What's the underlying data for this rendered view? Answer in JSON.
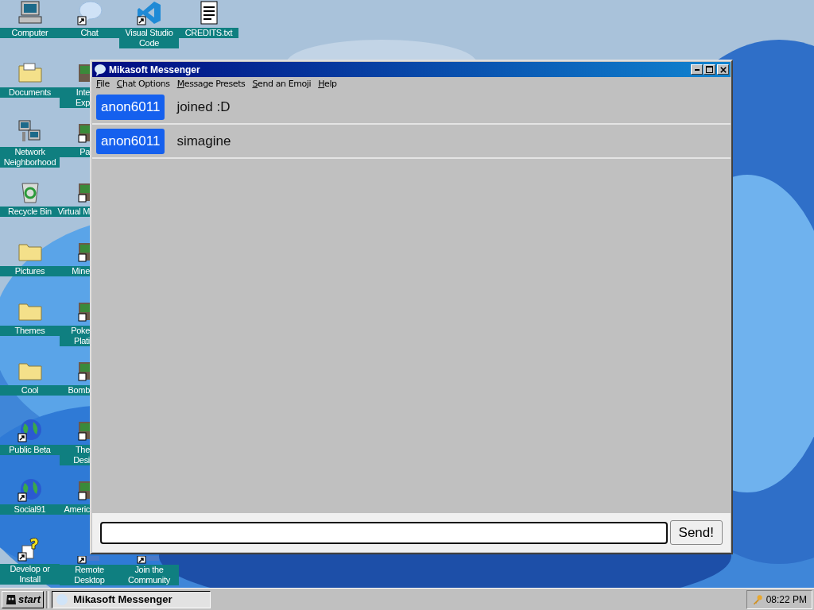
{
  "desktop": {
    "columns": [
      {
        "items": [
          {
            "kind": "computer",
            "shortcut": false,
            "lines": [
              "Computer"
            ]
          },
          {
            "kind": "folder-docs",
            "shortcut": false,
            "lines": [
              "Documents"
            ]
          },
          {
            "kind": "network",
            "shortcut": false,
            "lines": [
              "Network",
              "Neighborhood"
            ]
          },
          {
            "kind": "recycle",
            "shortcut": false,
            "lines": [
              "Recycle Bin"
            ]
          },
          {
            "kind": "folder",
            "shortcut": false,
            "lines": [
              "Pictures"
            ]
          },
          {
            "kind": "folder",
            "shortcut": false,
            "lines": [
              "Themes"
            ]
          },
          {
            "kind": "folder",
            "shortcut": false,
            "lines": [
              "Cool"
            ]
          },
          {
            "kind": "globe",
            "shortcut": true,
            "lines": [
              "Public Beta"
            ]
          },
          {
            "kind": "globe",
            "shortcut": true,
            "lines": [
              "Social91"
            ]
          },
          {
            "kind": "help",
            "shortcut": true,
            "lines": [
              "Develop or",
              "Install"
            ]
          }
        ]
      },
      {
        "items": [
          {
            "kind": "bubble",
            "shortcut": true,
            "lines": [
              "Chat"
            ]
          },
          {
            "kind": "edge",
            "shortcut": false,
            "lines": [
              "Inte",
              "Exp"
            ]
          },
          {
            "kind": "edge",
            "shortcut": true,
            "lines": [
              "Pa"
            ]
          },
          {
            "kind": "edge",
            "shortcut": true,
            "lines": [
              "Virtual M"
            ]
          },
          {
            "kind": "edge",
            "shortcut": true,
            "lines": [
              "Mine"
            ]
          },
          {
            "kind": "edge",
            "shortcut": true,
            "lines": [
              "Poke",
              "Plati"
            ]
          },
          {
            "kind": "edge",
            "shortcut": true,
            "lines": [
              "Bomb"
            ]
          },
          {
            "kind": "edge",
            "shortcut": true,
            "lines": [
              "The",
              "Desi"
            ]
          },
          {
            "kind": "edge",
            "shortcut": true,
            "lines": [
              "Americ"
            ]
          },
          {
            "kind": "stub",
            "shortcut": true,
            "lines": [
              "Remote",
              "Desktop"
            ]
          }
        ]
      },
      {
        "items": [
          {
            "kind": "vs",
            "shortcut": true,
            "lines": [
              "Visual Studio",
              "Code"
            ]
          }
        ],
        "bottom_items": [
          {
            "kind": "stub",
            "shortcut": true,
            "lines": [
              "Join the",
              "Community"
            ]
          }
        ]
      },
      {
        "items": [
          {
            "kind": "doc",
            "shortcut": false,
            "lines": [
              "CREDITS.txt"
            ]
          }
        ]
      }
    ]
  },
  "window": {
    "title": "Mikasoft Messenger",
    "active": true,
    "menu": [
      "File",
      "Chat Options",
      "Message Presets",
      "Send an Emoji",
      "Help"
    ],
    "messages": [
      {
        "user": "anon6011",
        "text": "joined :D"
      },
      {
        "user": "anon6011",
        "text": "simagine"
      }
    ],
    "send_button": "Send!"
  },
  "taskbar": {
    "start": "start",
    "tasks": [
      {
        "label": "Mikasoft Messenger",
        "selected": true
      }
    ],
    "clock": "08:22 PM"
  }
}
